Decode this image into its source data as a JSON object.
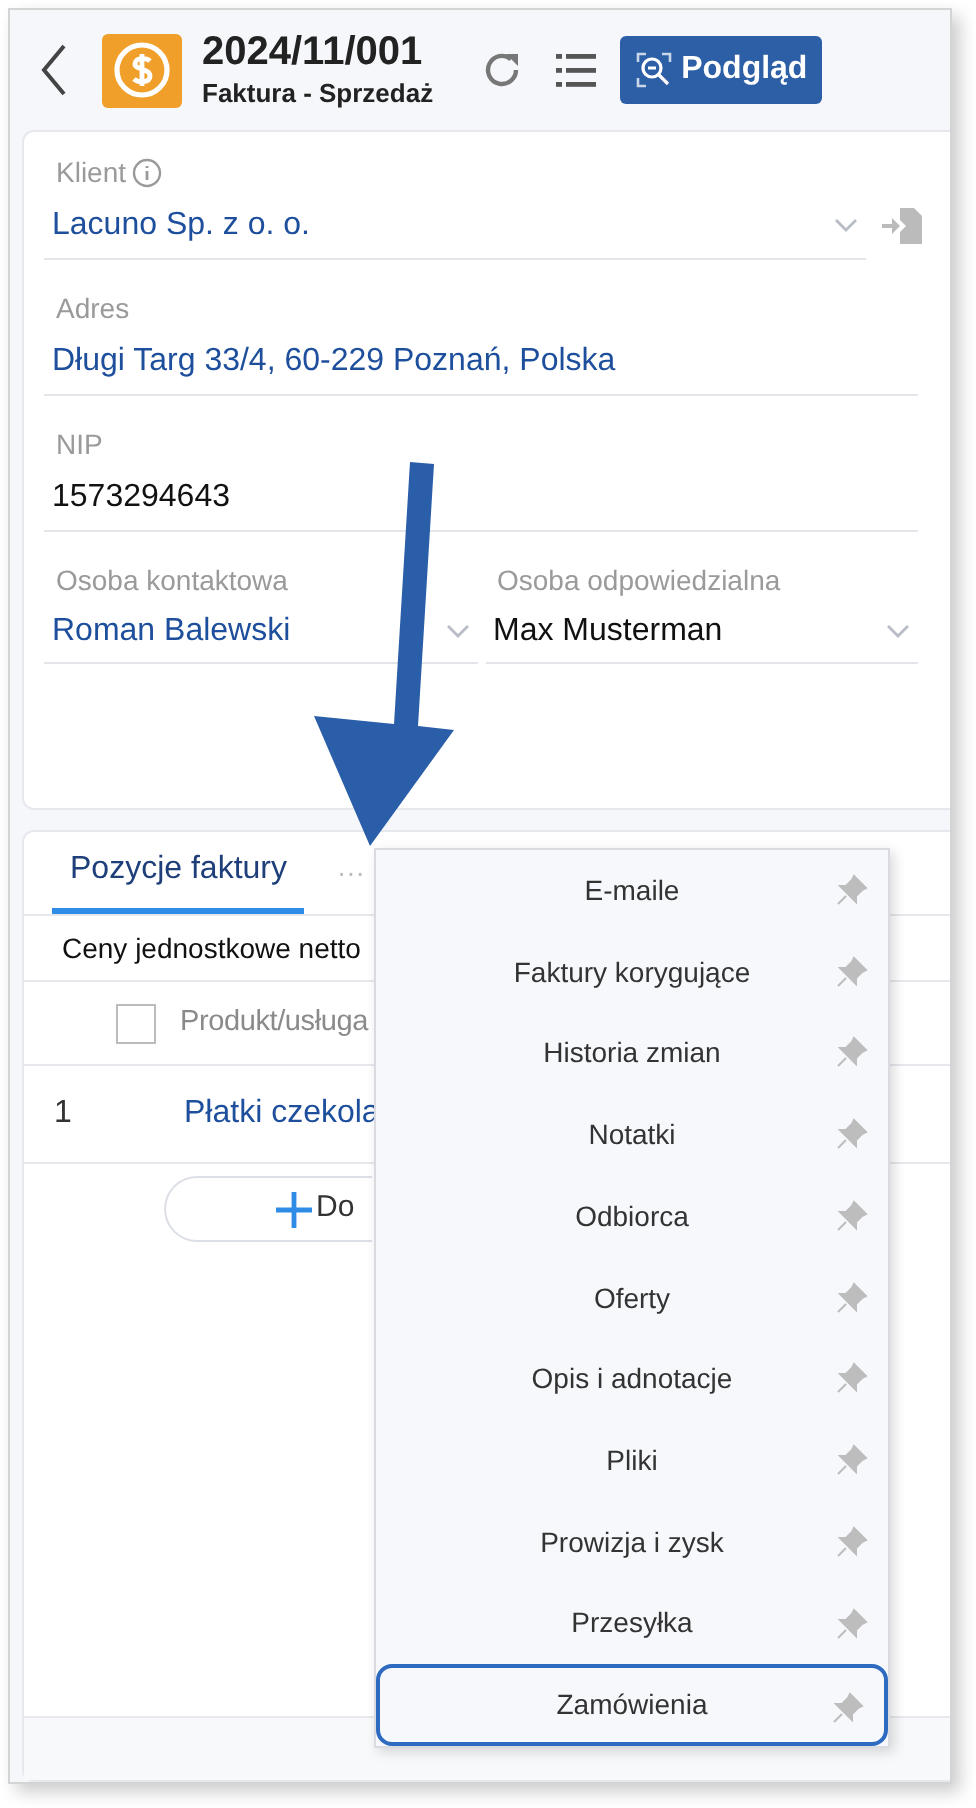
{
  "header": {
    "title": "2024/11/001",
    "subtitle": "Faktura - Sprzedaż",
    "preview_button": "Podgląd"
  },
  "form": {
    "fields": [
      {
        "label": "Klient",
        "value": "Lacuno Sp. z o. o.",
        "kind": "select"
      },
      {
        "label": "Adres",
        "value": "Długi Targ 33/4, 60-229 Poznań, Polska",
        "kind": "link"
      },
      {
        "label": "NIP",
        "value": "1573294643",
        "kind": "plain"
      }
    ],
    "columns": [
      {
        "label": "Osoba kontaktowa",
        "value": "Roman Balewski",
        "kind": "link"
      },
      {
        "label": "Osoba odpowiedzialna",
        "value": "Max Musterman",
        "kind": "plain"
      }
    ]
  },
  "tabs": [
    {
      "label": "Pozycje faktury",
      "selected": true
    }
  ],
  "more_tabs": "···",
  "items_section": {
    "note": "Ceny jednostkowe netto",
    "column_header": "Produkt/usługa",
    "header_checked": false,
    "rows": [
      {
        "number": "1",
        "product": "Płatki czekola"
      }
    ],
    "add_button": "Do"
  },
  "menu": {
    "items": [
      {
        "label": "E-maile",
        "selected": false
      },
      {
        "label": "Faktury korygujące",
        "selected": false
      },
      {
        "label": "Historia zmian",
        "selected": false
      },
      {
        "label": "Notatki",
        "selected": false
      },
      {
        "label": "Odbiorca",
        "selected": false
      },
      {
        "label": "Oferty",
        "selected": false
      },
      {
        "label": "Opis i adnotacje",
        "selected": false
      },
      {
        "label": "Pliki",
        "selected": false
      },
      {
        "label": "Prowizja i zysk",
        "selected": false
      },
      {
        "label": "Przesyłka",
        "selected": false
      },
      {
        "label": "Zamówienia",
        "selected": true
      }
    ]
  }
}
